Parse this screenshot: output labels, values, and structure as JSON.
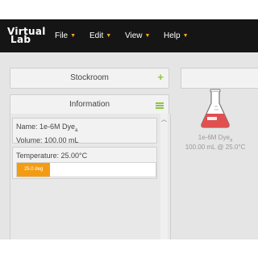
{
  "header": {
    "logo_line1": "Virtual",
    "logo_line2": "Lab",
    "menu": [
      {
        "label": "File"
      },
      {
        "label": "Edit"
      },
      {
        "label": "View"
      },
      {
        "label": "Help"
      }
    ]
  },
  "sidebar": {
    "stockroom_title": "Stockroom",
    "information_title": "Information",
    "name_label": "Name: 1e-6M Dye",
    "name_subscript": "a",
    "volume_label": "Volume: 100.00 mL",
    "temperature_label": "Temperature: 25.00°C",
    "temperature_bar_text": "25.0 deg",
    "temperature_fill_fraction": 0.24
  },
  "workbench": {
    "flask_name": "1e-6M Dye",
    "flask_name_subscript": "a",
    "flask_detail": "100.00 mL @ 25.0°C",
    "liquid_color": "#e05050"
  },
  "colors": {
    "accent_green": "#8dc63f",
    "accent_orange": "#f39c12",
    "topbar": "#151515"
  }
}
